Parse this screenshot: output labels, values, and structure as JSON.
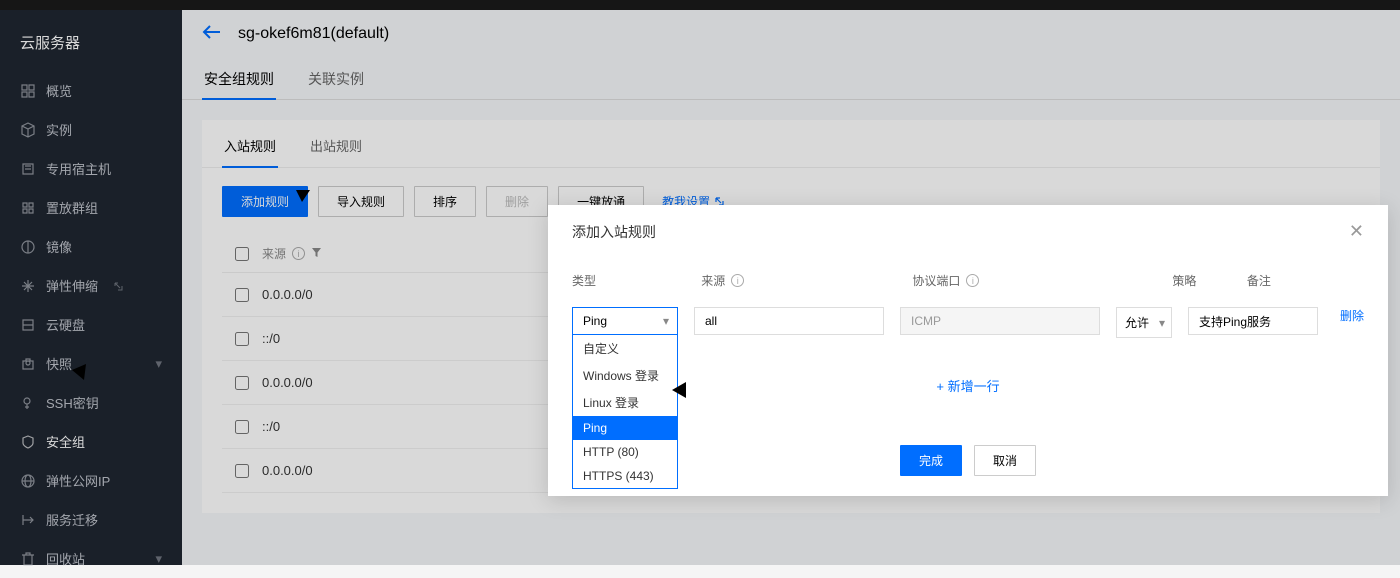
{
  "sidebar": {
    "title": "云服务器",
    "items": [
      {
        "label": "概览",
        "icon": "grid"
      },
      {
        "label": "实例",
        "icon": "cube"
      },
      {
        "label": "专用宿主机",
        "icon": "host"
      },
      {
        "label": "置放群组",
        "icon": "group"
      },
      {
        "label": "镜像",
        "icon": "mirror"
      },
      {
        "label": "弹性伸缩",
        "icon": "scale",
        "ext": true
      },
      {
        "label": "云硬盘",
        "icon": "disk"
      },
      {
        "label": "快照",
        "icon": "camera",
        "chevron": true
      },
      {
        "label": "SSH密钥",
        "icon": "key"
      },
      {
        "label": "安全组",
        "icon": "shield",
        "active": true
      },
      {
        "label": "弹性公网IP",
        "icon": "ip"
      },
      {
        "label": "服务迁移",
        "icon": "migrate"
      },
      {
        "label": "回收站",
        "icon": "trash",
        "chevron": true
      }
    ]
  },
  "page": {
    "title": "sg-okef6m81(default)"
  },
  "tabs": [
    {
      "label": "安全组规则",
      "active": true
    },
    {
      "label": "关联实例"
    }
  ],
  "sub_tabs": [
    {
      "label": "入站规则",
      "active": true
    },
    {
      "label": "出站规则"
    }
  ],
  "toolbar": {
    "add": "添加规则",
    "import": "导入规则",
    "sort": "排序",
    "delete": "删除",
    "allow_all": "一键放通",
    "help": "教我设置"
  },
  "table": {
    "header_source": "来源",
    "rows": [
      {
        "source": "0.0.0.0/0"
      },
      {
        "source": "::/0"
      },
      {
        "source": "0.0.0.0/0"
      },
      {
        "source": "::/0"
      },
      {
        "source": "0.0.0.0/0"
      }
    ]
  },
  "modal": {
    "title": "添加入站规则",
    "headers": {
      "type": "类型",
      "source": "来源",
      "protocol": "协议端口",
      "policy": "策略",
      "remark": "备注"
    },
    "row": {
      "type_selected": "Ping",
      "type_options": [
        "自定义",
        "Windows 登录",
        "Linux 登录",
        "Ping",
        "HTTP (80)",
        "HTTPS (443)"
      ],
      "source_value": "all",
      "protocol_value": "ICMP",
      "policy_selected": "允许",
      "remark_value": "支持Ping服务",
      "delete": "删除"
    },
    "add_row": "+ 新增一行",
    "confirm": "完成",
    "cancel": "取消"
  }
}
